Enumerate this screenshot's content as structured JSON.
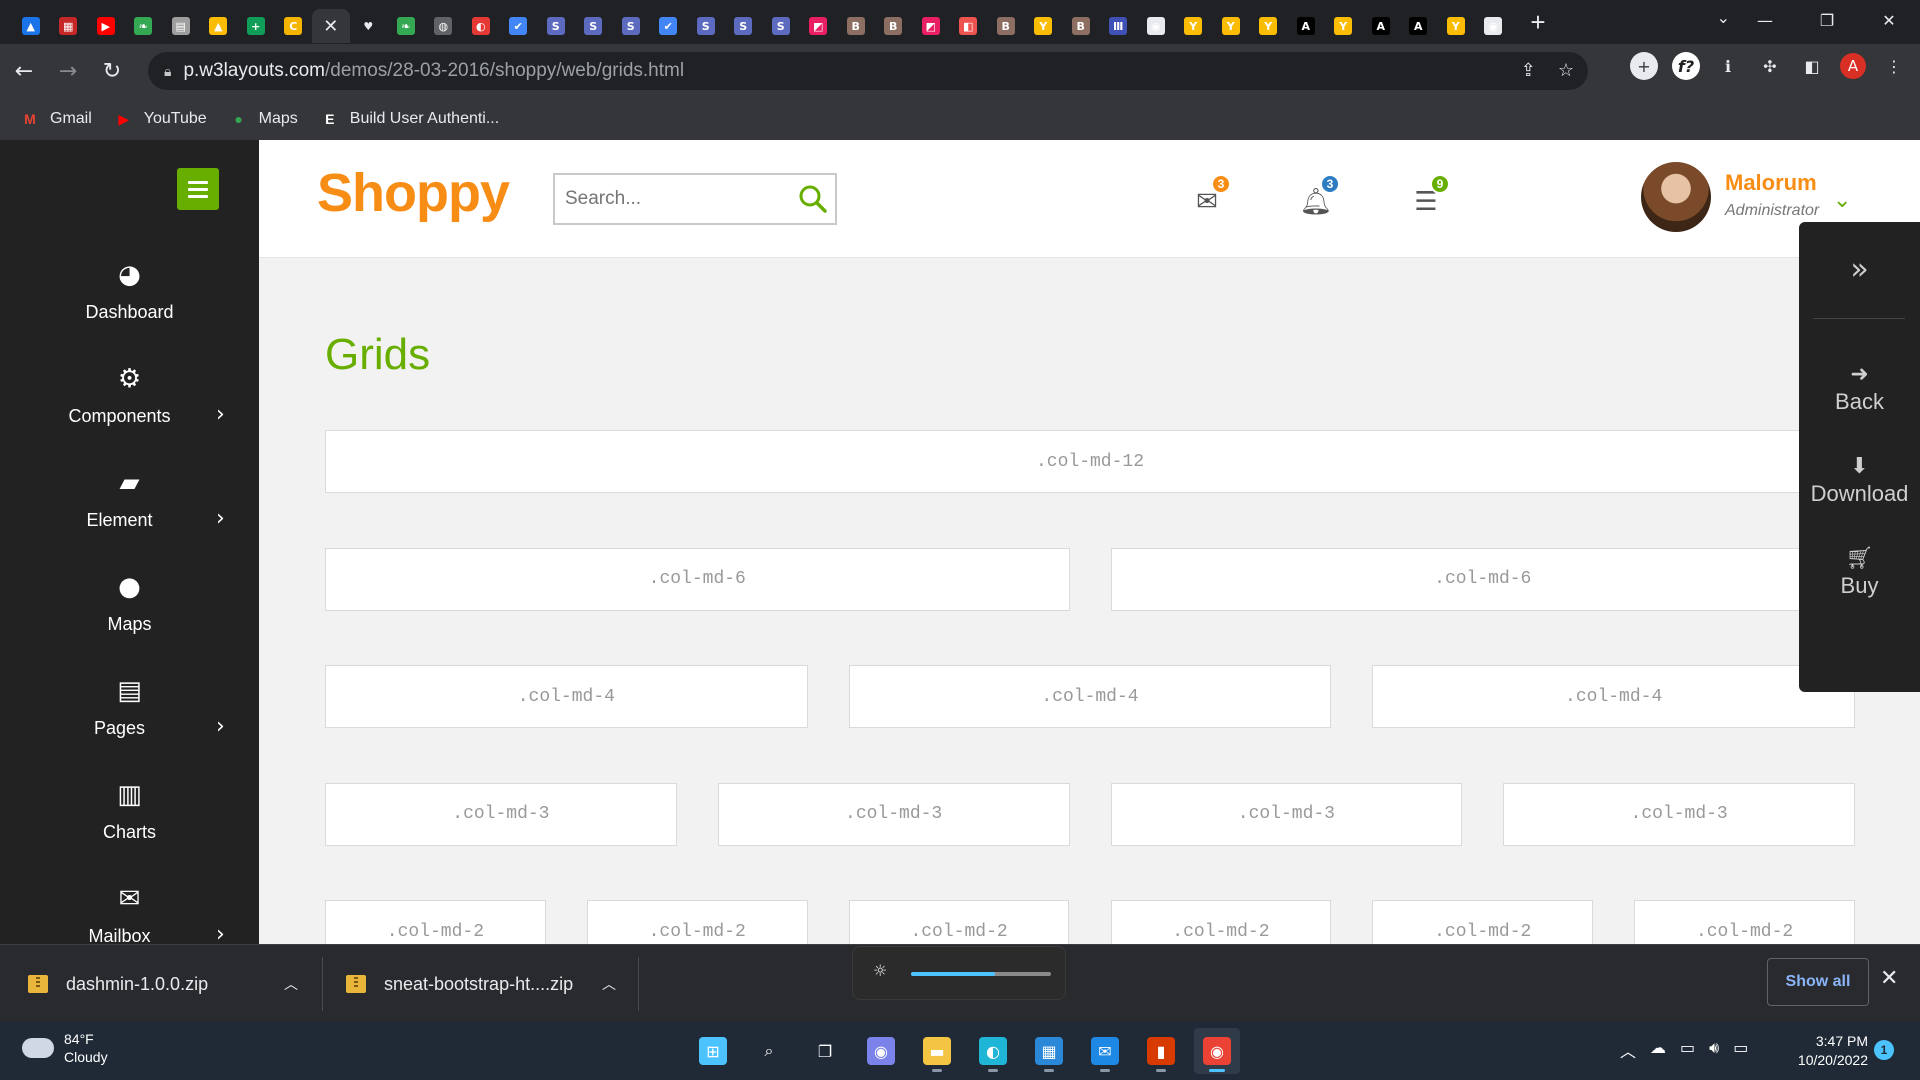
{
  "browser": {
    "tabs": [
      {
        "icon": "google-drive-icon",
        "color": "#1a73e8",
        "glyph": "▲"
      },
      {
        "icon": "app-icon",
        "color": "#c62828",
        "glyph": "▦"
      },
      {
        "icon": "youtube-icon",
        "color": "#ff0000",
        "glyph": "▶"
      },
      {
        "icon": "leaf-icon",
        "color": "#34a853",
        "glyph": "❧"
      },
      {
        "icon": "doc-icon",
        "color": "#9e9e9e",
        "glyph": "▤"
      },
      {
        "icon": "google-drive-icon",
        "color": "#fbbc04",
        "glyph": "▲"
      },
      {
        "icon": "sheets-icon",
        "color": "#0f9d58",
        "glyph": "+"
      },
      {
        "icon": "c-icon",
        "color": "#f4b400",
        "glyph": "C"
      },
      {
        "icon": "close-icon",
        "color": "",
        "glyph": "✕",
        "active": true
      },
      {
        "icon": "heart-icon",
        "color": "",
        "glyph": "♥"
      },
      {
        "icon": "leaf-icon",
        "color": "#34a853",
        "glyph": "❧"
      },
      {
        "icon": "globe-icon",
        "color": "#5f6368",
        "glyph": "◍"
      },
      {
        "icon": "app-icon",
        "color": "#e53935",
        "glyph": "◐"
      },
      {
        "icon": "check-icon",
        "color": "#4285f4",
        "glyph": "✔"
      },
      {
        "icon": "s-icon",
        "color": "#5c6bc0",
        "glyph": "S"
      },
      {
        "icon": "s-icon",
        "color": "#5c6bc0",
        "glyph": "S"
      },
      {
        "icon": "s-icon",
        "color": "#5c6bc0",
        "glyph": "S"
      },
      {
        "icon": "check-icon",
        "color": "#4285f4",
        "glyph": "✔"
      },
      {
        "icon": "s-icon",
        "color": "#5c6bc0",
        "glyph": "S"
      },
      {
        "icon": "s-icon",
        "color": "#5c6bc0",
        "glyph": "S"
      },
      {
        "icon": "s-icon",
        "color": "#5c6bc0",
        "glyph": "S"
      },
      {
        "icon": "app-icon",
        "color": "#e91e63",
        "glyph": "◩"
      },
      {
        "icon": "book-icon",
        "color": "#8d6e63",
        "glyph": "B"
      },
      {
        "icon": "book-icon",
        "color": "#8d6e63",
        "glyph": "B"
      },
      {
        "icon": "app-icon",
        "color": "#e91e63",
        "glyph": "◩"
      },
      {
        "icon": "app-icon",
        "color": "#ef5350",
        "glyph": "◧"
      },
      {
        "icon": "book-icon",
        "color": "#8d6e63",
        "glyph": "B"
      },
      {
        "icon": "y-icon",
        "color": "#fbbc04",
        "glyph": "Y"
      },
      {
        "icon": "book-icon",
        "color": "#8d6e63",
        "glyph": "B"
      },
      {
        "icon": "bars-icon",
        "color": "#3f51b5",
        "glyph": "Ⅲ"
      },
      {
        "icon": "github-icon",
        "color": "#e8eaed",
        "glyph": "◉"
      },
      {
        "icon": "y-icon",
        "color": "#fbbc04",
        "glyph": "Y"
      },
      {
        "icon": "y-icon",
        "color": "#fbbc04",
        "glyph": "Y"
      },
      {
        "icon": "y-icon",
        "color": "#fbbc04",
        "glyph": "Y"
      },
      {
        "icon": "a-icon",
        "color": "#000000",
        "glyph": "A"
      },
      {
        "icon": "y-icon",
        "color": "#fbbc04",
        "glyph": "Y"
      },
      {
        "icon": "a-icon",
        "color": "#000000",
        "glyph": "A"
      },
      {
        "icon": "a-icon",
        "color": "#000000",
        "glyph": "A"
      },
      {
        "icon": "y-icon",
        "color": "#fbbc04",
        "glyph": "Y"
      },
      {
        "icon": "github-icon",
        "color": "#e8eaed",
        "glyph": "◉"
      }
    ],
    "new_tab_glyph": "+",
    "url_host": "p.w3layouts.com",
    "url_path": "/demos/28-03-2016/shoppy/web/grids.html",
    "profile_initial": "A",
    "bookmarks": [
      {
        "label": "Gmail",
        "icon": "gmail-icon",
        "glyph": "M",
        "color": "#ea4335"
      },
      {
        "label": "YouTube",
        "icon": "youtube-icon",
        "glyph": "▶",
        "color": "#ff0000"
      },
      {
        "label": "Maps",
        "icon": "maps-icon",
        "glyph": "●",
        "color": "#34a853"
      },
      {
        "label": "Build User Authenti...",
        "icon": "e-icon",
        "glyph": "E",
        "color": "#ffffff"
      }
    ]
  },
  "app": {
    "logo": "Shoppy",
    "search_placeholder": "Search...",
    "notifications": {
      "mail": "3",
      "bell": "3",
      "tasks": "9"
    },
    "badge_colors": {
      "mail": "#f88d16",
      "bell": "#2d7cc1",
      "tasks": "#68ae00"
    },
    "user": {
      "name": "Malorum",
      "role": "Administrator"
    },
    "sidebar": [
      {
        "label": "Dashboard",
        "icon": "dashboard-icon",
        "glyph": "◕",
        "submenu": false
      },
      {
        "label": "Components",
        "icon": "cogs-icon",
        "glyph": "⚙",
        "submenu": true
      },
      {
        "label": "Element",
        "icon": "book-icon",
        "glyph": "▰",
        "submenu": true
      },
      {
        "label": "Maps",
        "icon": "map-marker-icon",
        "glyph": "●",
        "submenu": false
      },
      {
        "label": "Pages",
        "icon": "file-icon",
        "glyph": "▤",
        "submenu": true
      },
      {
        "label": "Charts",
        "icon": "bar-chart-icon",
        "glyph": "▥",
        "submenu": false
      },
      {
        "label": "Mailbox",
        "icon": "envelope-icon",
        "glyph": "✉",
        "submenu": true
      }
    ],
    "page_title": "Grids",
    "grid_rows": [
      [
        ".col-md-12"
      ],
      [
        ".col-md-6",
        ".col-md-6"
      ],
      [
        ".col-md-4",
        ".col-md-4",
        ".col-md-4"
      ],
      [
        ".col-md-3",
        ".col-md-3",
        ".col-md-3",
        ".col-md-3"
      ],
      [
        ".col-md-2",
        ".col-md-2",
        ".col-md-2",
        ".col-md-2",
        ".col-md-2",
        ".col-md-2"
      ]
    ],
    "float_panel": {
      "back": "Back",
      "download": "Download",
      "buy": "Buy"
    }
  },
  "downloads": {
    "items": [
      "dashmin-1.0.0.zip",
      "sneat-bootstrap-ht....zip"
    ],
    "show_all": "Show all",
    "brightness_level": 0.6
  },
  "taskbar": {
    "weather_temp": "84°F",
    "weather_desc": "Cloudy",
    "time": "3:47 PM",
    "date": "10/20/2022",
    "notification_count": "1",
    "apps": [
      {
        "icon": "windows-start-icon",
        "glyph": "⊞",
        "color": "#4cc2ff"
      },
      {
        "icon": "search-icon",
        "glyph": "⌕",
        "color": ""
      },
      {
        "icon": "task-view-icon",
        "glyph": "❐",
        "color": ""
      },
      {
        "icon": "teams-chat-icon",
        "glyph": "◉",
        "color": "#7b83eb"
      },
      {
        "icon": "file-explorer-icon",
        "glyph": "▬",
        "color": "#f4c542"
      },
      {
        "icon": "edge-icon",
        "glyph": "◐",
        "color": "#1fb5d6"
      },
      {
        "icon": "store-icon",
        "glyph": "▦",
        "color": "#2b88d8"
      },
      {
        "icon": "mail-icon",
        "glyph": "✉",
        "color": "#1e88e5"
      },
      {
        "icon": "office-icon",
        "glyph": "▮",
        "color": "#d83b01"
      },
      {
        "icon": "chrome-icon",
        "glyph": "◉",
        "color": "#ea4335",
        "active": true
      }
    ]
  }
}
